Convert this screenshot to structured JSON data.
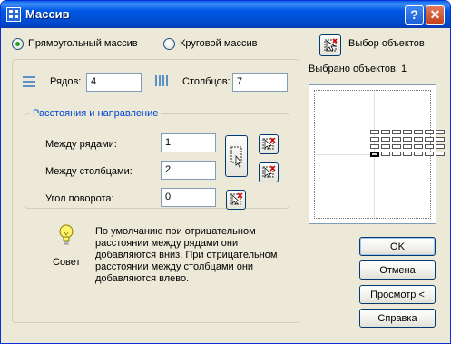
{
  "window": {
    "title": "Массив",
    "help_button": "?",
    "close_button": "✕"
  },
  "array_type": {
    "rectangular_label": "Прямоугольный массив",
    "rectangular_selected": true,
    "polar_label": "Круговой массив"
  },
  "select_objects": {
    "label": "Выбор объектов",
    "count_text": "Выбрано объектов: 1"
  },
  "rows": {
    "label": "Рядов:",
    "value": "4"
  },
  "columns": {
    "label": "Столбцов:",
    "value": "7"
  },
  "offset_group": {
    "title": "Расстояния и направление",
    "row_offset_label": "Между рядами:",
    "row_offset_value": "1",
    "column_offset_label": "Между столбцами:",
    "column_offset_value": "2",
    "angle_label": "Угол поворота:",
    "angle_value": "0"
  },
  "tip": {
    "label": "Совет",
    "text": "По умолчанию при отрицательном расстоянии между рядами они добавляются вниз. При отрицательном расстоянии между столбцами они добавляются влево."
  },
  "buttons": {
    "ok": "OK",
    "cancel": "Отмена",
    "preview": "Просмотр <",
    "help": "Справка"
  },
  "icons": {
    "app": "array-app-icon",
    "rows": "rows-icon",
    "columns": "columns-icon",
    "pick": "pick-point-icon",
    "tip": "lightbulb-icon"
  },
  "colors": {
    "titlebar": "#0054e3",
    "dialog_bg": "#ece9d8",
    "group_title": "#0046d5",
    "radio_dot": "#21a121"
  }
}
